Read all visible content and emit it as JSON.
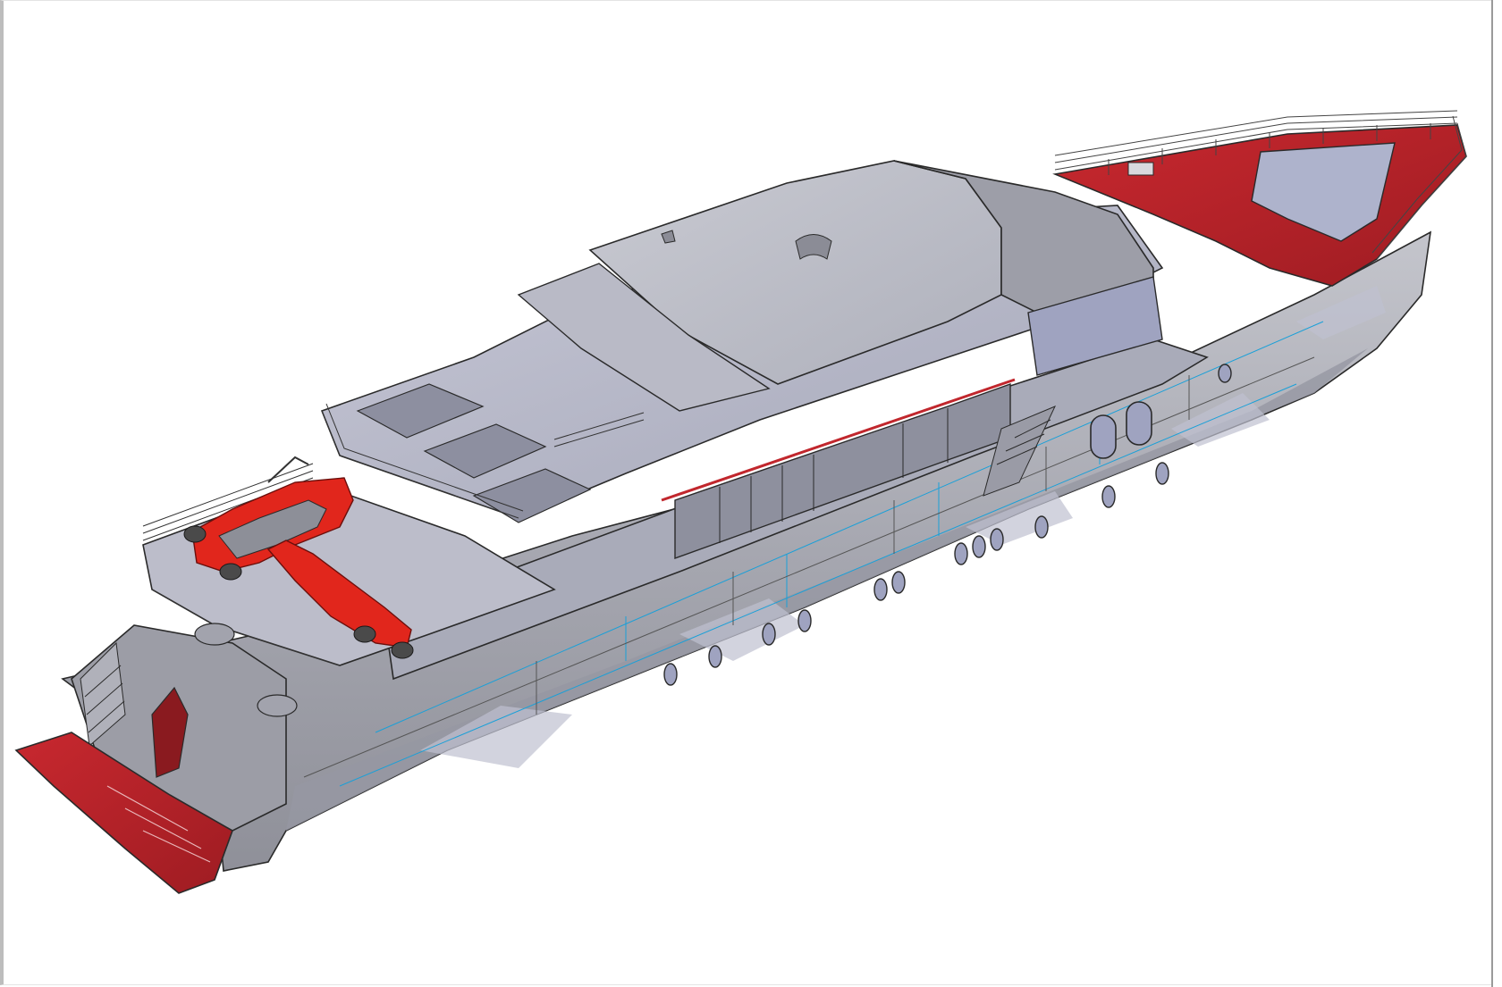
{
  "viewport": {
    "background_color": "#ffffff"
  },
  "model": {
    "subject": "yacht-3d-cad-model",
    "view": "isometric",
    "colors": {
      "hull_light": "#c9c9cc",
      "hull_mid": "#a9aab2",
      "hull_dark": "#8c8c94",
      "superstructure": "#b6b6c4",
      "glazing_blue": "#aeb4d6",
      "deck_red": "#c1272d",
      "tender_red": "#e1261c",
      "edge_line": "#2a2a2a",
      "construction_line": "#1aa0d8"
    }
  }
}
